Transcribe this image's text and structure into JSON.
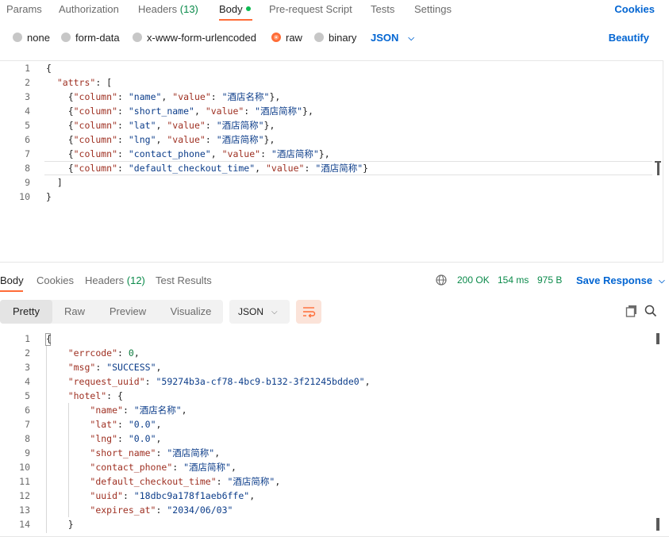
{
  "request_tabs": [
    {
      "label": "Params"
    },
    {
      "label": "Authorization"
    },
    {
      "label": "Headers",
      "count": "(13)"
    },
    {
      "label": "Body"
    },
    {
      "label": "Pre-request Script"
    },
    {
      "label": "Tests"
    },
    {
      "label": "Settings"
    }
  ],
  "cookies_label": "Cookies",
  "body_types": [
    "none",
    "form-data",
    "x-www-form-urlencoded",
    "raw",
    "binary"
  ],
  "body_format": "JSON",
  "beautify_label": "Beautify",
  "request_code": [
    {
      "num": "1",
      "text": "{"
    },
    {
      "num": "2",
      "text": "  \"attrs\": ["
    },
    {
      "num": "3",
      "text": "    {\"column\": \"name\", \"value\": \"酒店名称\"},"
    },
    {
      "num": "4",
      "text": "    {\"column\": \"short_name\", \"value\": \"酒店简称\"},"
    },
    {
      "num": "5",
      "text": "    {\"column\": \"lat\", \"value\": \"酒店简称\"},"
    },
    {
      "num": "6",
      "text": "    {\"column\": \"lng\", \"value\": \"酒店简称\"},"
    },
    {
      "num": "7",
      "text": "    {\"column\": \"contact_phone\", \"value\": \"酒店简称\"},"
    },
    {
      "num": "8",
      "text": "    {\"column\": \"default_checkout_time\", \"value\": \"酒店简称\"}"
    },
    {
      "num": "9",
      "text": "  ]"
    },
    {
      "num": "10",
      "text": "}"
    }
  ],
  "response_tabs": [
    {
      "label": "Body"
    },
    {
      "label": "Cookies"
    },
    {
      "label": "Headers",
      "count": "(12)"
    },
    {
      "label": "Test Results"
    }
  ],
  "response_status": {
    "code": "200 OK",
    "time": "154 ms",
    "size": "975 B"
  },
  "save_response_label": "Save Response",
  "view_modes": [
    "Pretty",
    "Raw",
    "Preview",
    "Visualize"
  ],
  "response_format": "JSON",
  "response_code": [
    {
      "num": "1",
      "text": "{"
    },
    {
      "num": "2",
      "text": "    \"errcode\": 0,"
    },
    {
      "num": "3",
      "text": "    \"msg\": \"SUCCESS\","
    },
    {
      "num": "4",
      "text": "    \"request_uuid\": \"59274b3a-cf78-4bc9-b132-3f21245bdde0\","
    },
    {
      "num": "5",
      "text": "    \"hotel\": {"
    },
    {
      "num": "6",
      "text": "        \"name\": \"酒店名称\","
    },
    {
      "num": "7",
      "text": "        \"lat\": \"0.0\","
    },
    {
      "num": "8",
      "text": "        \"lng\": \"0.0\","
    },
    {
      "num": "9",
      "text": "        \"short_name\": \"酒店简称\","
    },
    {
      "num": "10",
      "text": "        \"contact_phone\": \"酒店简称\","
    },
    {
      "num": "11",
      "text": "        \"default_checkout_time\": \"酒店简称\","
    },
    {
      "num": "12",
      "text": "        \"uuid\": \"18dbc9a178f1aeb6ffe\","
    },
    {
      "num": "13",
      "text": "        \"expires_at\": \"2034/06/03\""
    },
    {
      "num": "14",
      "text": "    }"
    }
  ],
  "colors": {
    "accent": "#ff6c37",
    "link": "#0265d2",
    "status": "#0a8a4a"
  }
}
